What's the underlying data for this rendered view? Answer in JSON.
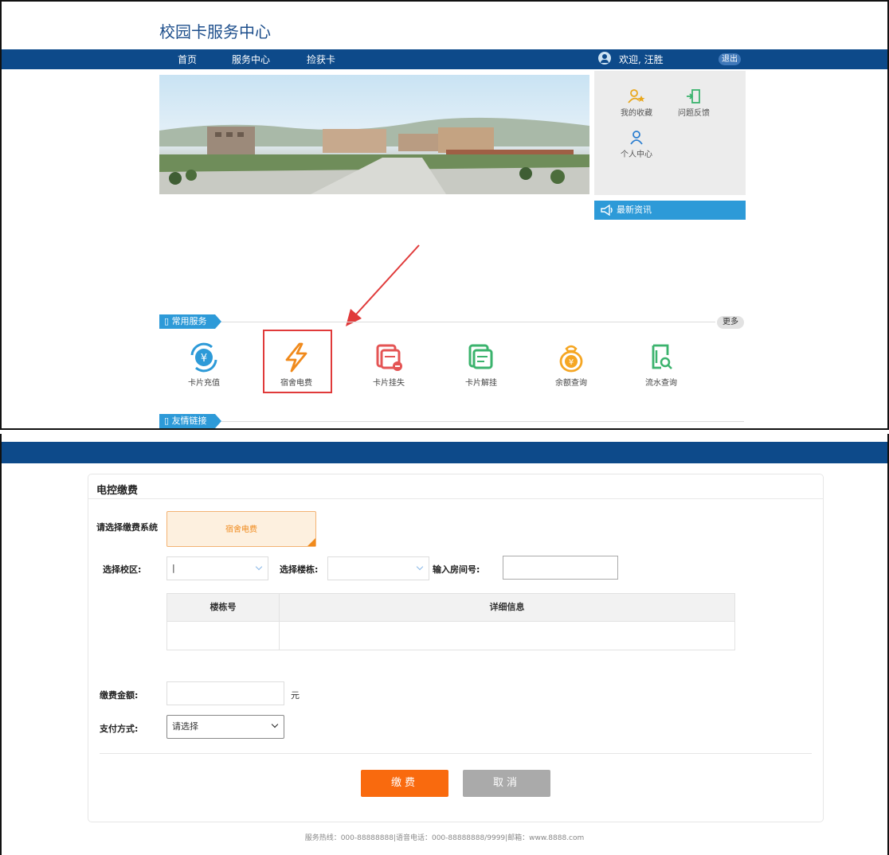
{
  "header": {
    "site_title": "校园卡服务中心"
  },
  "nav": {
    "items": [
      "首页",
      "服务中心",
      "捡获卡"
    ],
    "welcome": "欢迎, 汪胜",
    "logout": "退出"
  },
  "quick_links": {
    "favorites": "我的收藏",
    "feedback": "问题反馈",
    "profile": "个人中心"
  },
  "news": {
    "title": "最新资讯"
  },
  "services_section": {
    "title": "常用服务",
    "more": "更多"
  },
  "services": [
    {
      "label": "卡片充值",
      "icon": "recharge-icon",
      "color": "#2d9ad8"
    },
    {
      "label": "宿舍电费",
      "icon": "lightning-icon",
      "color": "#f08a1c"
    },
    {
      "label": "卡片挂失",
      "icon": "card-loss-icon",
      "color": "#e45454"
    },
    {
      "label": "卡片解挂",
      "icon": "card-unlock-icon",
      "color": "#3bb36d"
    },
    {
      "label": "余额查询",
      "icon": "money-bag-icon",
      "color": "#f5a623"
    },
    {
      "label": "流水查询",
      "icon": "transaction-query-icon",
      "color": "#3bb36d"
    }
  ],
  "links_section": {
    "title": "友情链接"
  },
  "payment": {
    "title": "电控缴费",
    "system_label": "请选择缴费系统",
    "system_option": "宿舍电费",
    "campus_label": "选择校区:",
    "campus_value": "|",
    "building_label": "选择楼栋:",
    "room_label": "输入房间号:",
    "table_headers": [
      "楼栋号",
      "详细信息"
    ],
    "amount_label": "缴费金额:",
    "amount_unit": "元",
    "method_label": "支付方式:",
    "method_value": "请选择",
    "pay_button": "缴费",
    "cancel_button": "取消"
  },
  "footer": {
    "text": "服务热线：000-88888888|语音电话：000-88888888/9999|邮箱：www.8888.com"
  },
  "colors": {
    "nav": "#0d4a8a",
    "accent": "#2d9ad8",
    "pay": "#f96a0e",
    "cancel": "#aaaaaa",
    "highlight": "#e03a3a"
  }
}
